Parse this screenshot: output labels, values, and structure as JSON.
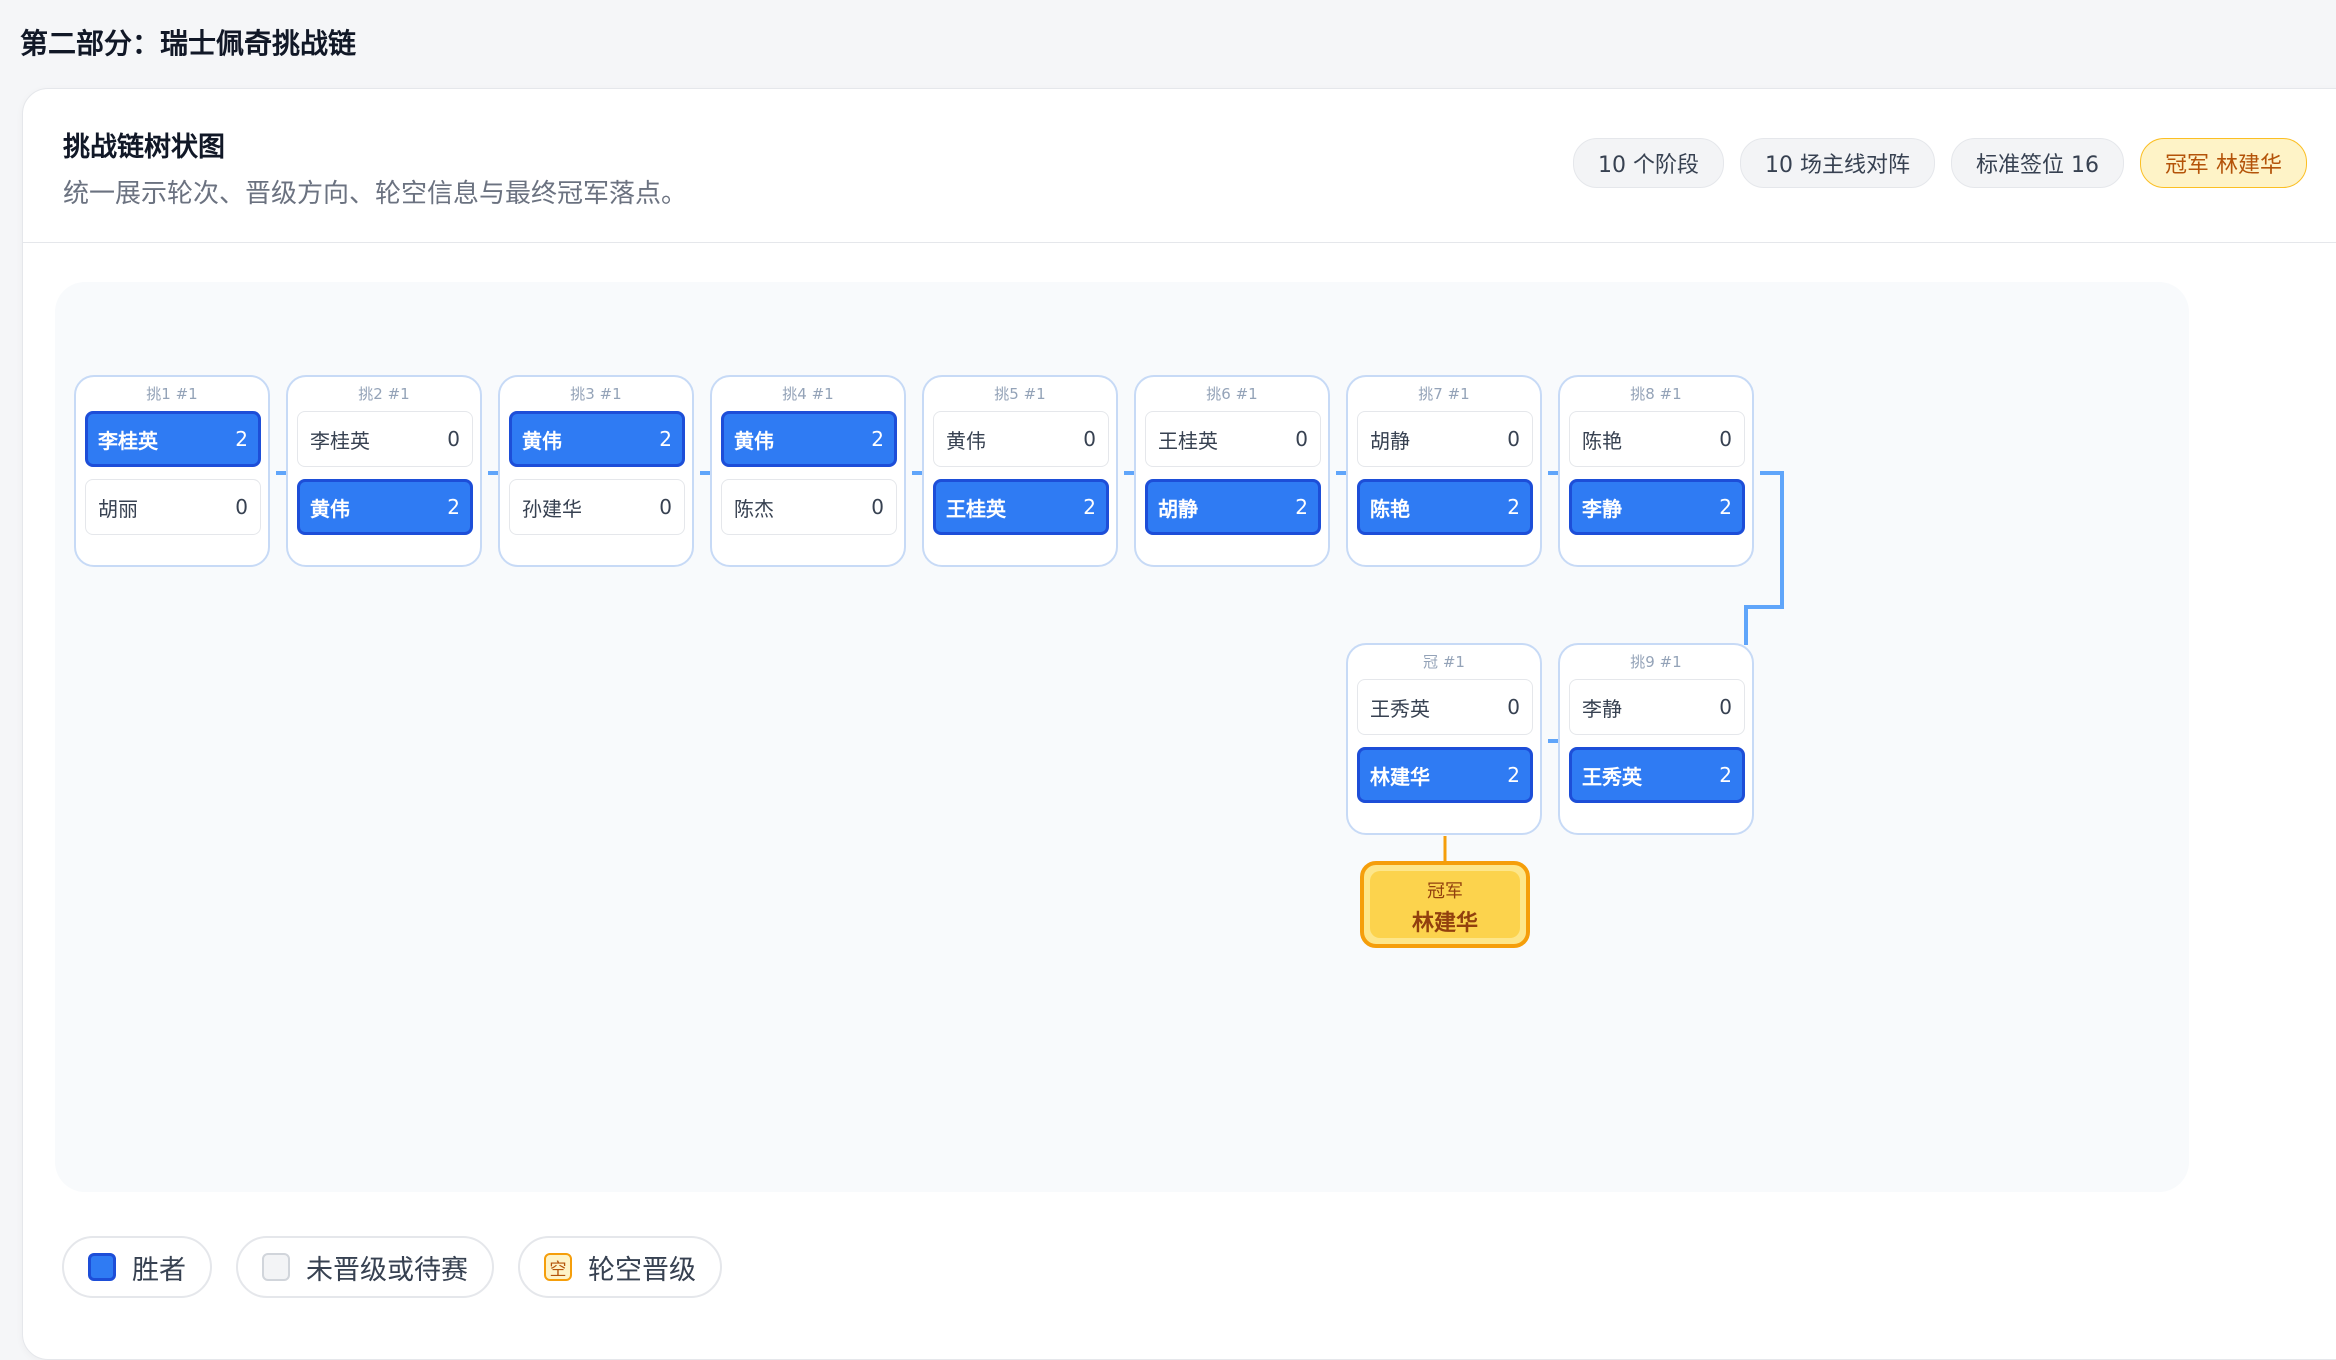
{
  "section_title": "第二部分：瑞士佩奇挑战链",
  "card": {
    "title": "挑战链树状图",
    "subtitle": "统一展示轮次、晋级方向、轮空信息与最终冠军落点。",
    "chips": {
      "stages": "10 个阶段",
      "matches": "10 场主线对阵",
      "seeds": "标准签位 16",
      "champion": "冠军 林建华"
    }
  },
  "matches": [
    {
      "label": "挑1 #1",
      "p1": "李桂英",
      "s1": "2",
      "p2": "胡丽",
      "s2": "0",
      "winner": 1
    },
    {
      "label": "挑2 #1",
      "p1": "李桂英",
      "s1": "0",
      "p2": "黄伟",
      "s2": "2",
      "winner": 2
    },
    {
      "label": "挑3 #1",
      "p1": "黄伟",
      "s1": "2",
      "p2": "孙建华",
      "s2": "0",
      "winner": 1
    },
    {
      "label": "挑4 #1",
      "p1": "黄伟",
      "s1": "2",
      "p2": "陈杰",
      "s2": "0",
      "winner": 1
    },
    {
      "label": "挑5 #1",
      "p1": "黄伟",
      "s1": "0",
      "p2": "王桂英",
      "s2": "2",
      "winner": 2
    },
    {
      "label": "挑6 #1",
      "p1": "王桂英",
      "s1": "0",
      "p2": "胡静",
      "s2": "2",
      "winner": 2
    },
    {
      "label": "挑7 #1",
      "p1": "胡静",
      "s1": "0",
      "p2": "陈艳",
      "s2": "2",
      "winner": 2
    },
    {
      "label": "挑8 #1",
      "p1": "陈艳",
      "s1": "0",
      "p2": "李静",
      "s2": "2",
      "winner": 2
    },
    {
      "label": "挑9 #1",
      "p1": "李静",
      "s1": "0",
      "p2": "王秀英",
      "s2": "2",
      "winner": 2
    },
    {
      "label": "冠 #1",
      "p1": "王秀英",
      "s1": "0",
      "p2": "林建华",
      "s2": "2",
      "winner": 2
    }
  ],
  "champion": {
    "label": "冠军",
    "name": "林建华"
  },
  "legend": {
    "winner": "胜者",
    "pending": "未晋级或待赛",
    "bye_icon": "空",
    "bye": "轮空晋级"
  },
  "colors": {
    "winner": "#2f7bf3",
    "connector": "#60a5fa",
    "champion": "#f59e0b"
  }
}
